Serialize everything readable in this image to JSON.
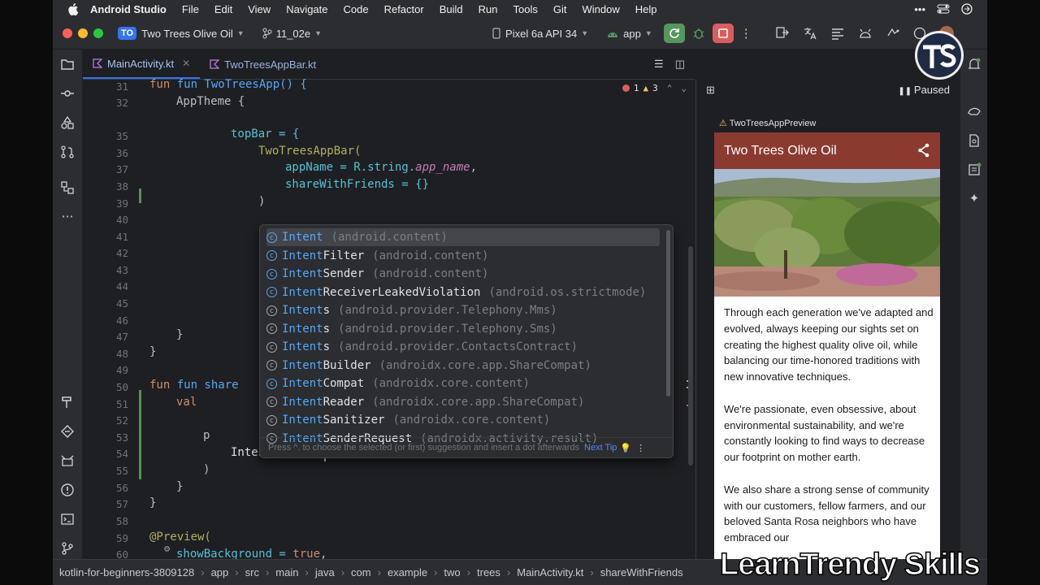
{
  "menubar": {
    "app_name": "Android Studio",
    "items": [
      "File",
      "Edit",
      "View",
      "Navigate",
      "Code",
      "Refactor",
      "Build",
      "Run",
      "Tools",
      "Git",
      "Window",
      "Help"
    ]
  },
  "toolbar": {
    "project_badge": "TO",
    "project_name": "Two Trees Olive Oil",
    "branch": "11_02e",
    "device": "Pixel 6a API 34",
    "run_config": "app"
  },
  "tabs": [
    {
      "label": "MainActivity.kt",
      "active": true
    },
    {
      "label": "TwoTreesAppBar.kt",
      "active": false
    }
  ],
  "inspections": {
    "errors": "1",
    "warnings": "3"
  },
  "editor": {
    "lines": [
      {
        "n": "31",
        "top": 0
      },
      {
        "n": "32"
      },
      {
        "n": "35"
      },
      {
        "n": "36"
      },
      {
        "n": "37"
      },
      {
        "n": "38"
      },
      {
        "n": "39"
      },
      {
        "n": "40"
      },
      {
        "n": "41"
      },
      {
        "n": "42"
      },
      {
        "n": "43"
      },
      {
        "n": "44"
      },
      {
        "n": "45"
      },
      {
        "n": "46"
      },
      {
        "n": "47"
      },
      {
        "n": "48"
      },
      {
        "n": "49"
      },
      {
        "n": "50"
      },
      {
        "n": "51"
      },
      {
        "n": "52"
      },
      {
        "n": "53"
      },
      {
        "n": "54"
      },
      {
        "n": "55"
      },
      {
        "n": "56"
      },
      {
        "n": "57"
      },
      {
        "n": "58"
      },
      {
        "n": "59"
      },
      {
        "n": "60"
      }
    ],
    "code": {
      "l31": "fun TwoTreesApp() {",
      "l32": "AppTheme {",
      "l35": "topBar = {",
      "l36": "TwoTreesAppBar(",
      "l37_a": "appName = R.string.",
      "l37_b": "app_name",
      "l37_c": ",",
      "l38": "shareWithFriends = {}",
      "l39": ")",
      "l47": "}",
      "l48": "}",
      "l50": "fun share",
      "l51": "val",
      "l53": "p",
      "l54": "Intent",
      "l55": ")",
      "l56": "}",
      "l57": "}",
      "l59": "@Preview(",
      "l60_a": "showBackground = ",
      "l60_b": "true",
      "l60_c": ","
    }
  },
  "completion": {
    "items": [
      {
        "match": "Intent",
        "rest": "",
        "pkg": "(android.content)",
        "alias": false
      },
      {
        "match": "Intent",
        "rest": "Filter",
        "pkg": "(android.content)",
        "alias": false
      },
      {
        "match": "Intent",
        "rest": "Sender",
        "pkg": "(android.content)",
        "alias": false
      },
      {
        "match": "Intent",
        "rest": "ReceiverLeakedViolation",
        "pkg": "(android.os.strictmode)",
        "alias": false
      },
      {
        "match": "Intent",
        "rest": "s",
        "pkg": "(android.provider.Telephony.Mms)",
        "alias": true
      },
      {
        "match": "Intent",
        "rest": "s",
        "pkg": "(android.provider.Telephony.Sms)",
        "alias": true
      },
      {
        "match": "Intent",
        "rest": "s",
        "pkg": "(android.provider.ContactsContract)",
        "alias": true
      },
      {
        "match": "Intent",
        "rest": "Builder",
        "pkg": "(androidx.core.app.ShareCompat)",
        "alias": true
      },
      {
        "match": "Intent",
        "rest": "Compat",
        "pkg": "(androidx.core.content)",
        "alias": false
      },
      {
        "match": "Intent",
        "rest": "Reader",
        "pkg": "(androidx.core.app.ShareCompat)",
        "alias": true
      },
      {
        "match": "Intent",
        "rest": "Sanitizer",
        "pkg": "(androidx.core.content)",
        "alias": true
      },
      {
        "match": "Intent",
        "rest": "SenderRequest",
        "pkg": "(androidx.activity.result)",
        "alias": true
      }
    ],
    "footer": "Press ^. to choose the selected (or first) suggestion and insert a dot afterwards",
    "next_tip": "Next Tip"
  },
  "preview": {
    "status": "Paused",
    "name": "TwoTreesAppPreview",
    "app_title": "Two Trees Olive Oil",
    "about": "Through each generation we've adapted and evolved, always keeping our sights set on creating the highest quality olive oil, while balancing our time-honored traditions with new innovative techniques.\n\n We're passionate, even obsessive, about environmental sustainability, and we're constantly looking to find ways to decrease our footprint on mother earth.\n\n We also share a strong sense of community with our customers, fellow farmers, and our beloved Santa Rosa neighbors who have embraced our"
  },
  "breadcrumb": [
    "kotlin-for-beginners-3809128",
    "app",
    "src",
    "main",
    "java",
    "com",
    "example",
    "two",
    "trees",
    "MainActivity.kt",
    "shareWithFriends"
  ],
  "watermark": "LearnTrendy Skills",
  "colors": {
    "accent": "#3574f0",
    "app_bar": "#8b3a30",
    "run_green": "#57965c",
    "stop_red": "#db5c5c"
  }
}
